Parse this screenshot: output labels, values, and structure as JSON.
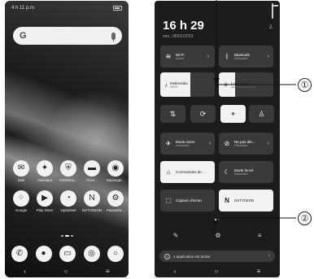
{
  "left_phone": {
    "status_time": "4 h 11 p.m.",
    "search": {
      "logo": "G"
    },
    "app_rows": [
      [
        {
          "label": "Mail",
          "icon": "mail-icon",
          "glyph": "✉"
        },
        {
          "label": "Assistant",
          "icon": "assistant-icon",
          "glyph": "✦"
        },
        {
          "label": "Gestionn...",
          "icon": "shield-icon",
          "glyph": "⛨"
        },
        {
          "label": "Fichi...",
          "icon": "folder-icon",
          "glyph": "▬"
        },
        {
          "label": "Sauvegar...",
          "icon": "backup-icon",
          "glyph": "◉"
        }
      ],
      [
        {
          "label": "Google",
          "icon": "google-folder-icon",
          "glyph": "⁘"
        },
        {
          "label": "Play Store",
          "icon": "play-store-icon",
          "glyph": "▶"
        },
        {
          "label": "Optimiser",
          "icon": "optimizer-icon",
          "glyph": "◔"
        },
        {
          "label": "NXTVISION",
          "icon": "nxtvision-icon",
          "glyph": "N"
        },
        {
          "label": "Paramètr...",
          "icon": "settings-icon",
          "glyph": "⚙"
        }
      ]
    ],
    "dock": [
      {
        "icon": "phone-icon",
        "glyph": "✆"
      },
      {
        "icon": "contacts-icon",
        "glyph": "●"
      },
      {
        "icon": "messages-icon",
        "glyph": "▭"
      },
      {
        "icon": "chrome-icon",
        "glyph": "◎"
      },
      {
        "icon": "camera-icon",
        "glyph": "○"
      }
    ],
    "nav": {
      "back": "‹",
      "home": "○",
      "recents": "≡"
    }
  },
  "right_phone": {
    "clock": "16 h 29",
    "date": "ven., 06/01/2023",
    "tiles": {
      "wifi": {
        "name": "Wi-Fi",
        "status": "Activé",
        "icon": "wifi-icon",
        "glyph": "≋"
      },
      "bluetooth": {
        "name": "Bluetooth",
        "status": "Désactivé",
        "icon": "bluetooth-icon",
        "glyph": "ᛒ"
      },
      "multimedia": {
        "name": "Multimédia",
        "status": "100%",
        "icon": "music-icon",
        "glyph": "♪",
        "level": 0.55
      },
      "brightness": {
        "name": "Luminosité",
        "status": "Automatique 84%",
        "icon": "brightness-icon",
        "glyph": "☀",
        "level": 0.3
      },
      "airplane": {
        "name": "Mode Avion",
        "status": "Désactivé",
        "icon": "airplane-icon",
        "glyph": "✈"
      },
      "dnd": {
        "name": "Ne pas dér...",
        "status": "Désactivé",
        "icon": "do-not-disturb-icon",
        "glyph": "⊘"
      },
      "home_controls": {
        "name": "Commandes de ...",
        "icon": "home-icon",
        "glyph": "⌂"
      },
      "dark_mode": {
        "name": "Mode foncé",
        "status": "Désactivé",
        "icon": "dark-mode-icon",
        "glyph": "☾"
      },
      "screenshot": {
        "name": "Capture d'écran",
        "icon": "screenshot-icon",
        "glyph": "⬚"
      },
      "nxtvision": {
        "name": "NXTVISION",
        "icon": "nxtvision-icon",
        "glyph": "N"
      }
    },
    "small_tiles": [
      {
        "icon": "mobile-data-icon",
        "glyph": "⇅"
      },
      {
        "icon": "auto-rotate-icon",
        "glyph": "⟳"
      },
      {
        "icon": "location-icon",
        "glyph": "⌖"
      },
      {
        "icon": "flashlight-icon",
        "glyph": "♙"
      }
    ],
    "bottom_actions": [
      {
        "icon": "edit-icon",
        "glyph": "✎"
      },
      {
        "icon": "settings-icon",
        "glyph": "⚙"
      },
      {
        "icon": "sort-icon",
        "glyph": "≡"
      }
    ],
    "notification": {
      "count": "1",
      "text": "1 application est active",
      "chevron": "›"
    },
    "nav": {
      "back": "‹",
      "home": "○",
      "recents": "≡"
    }
  },
  "callouts": [
    "①",
    "②"
  ]
}
